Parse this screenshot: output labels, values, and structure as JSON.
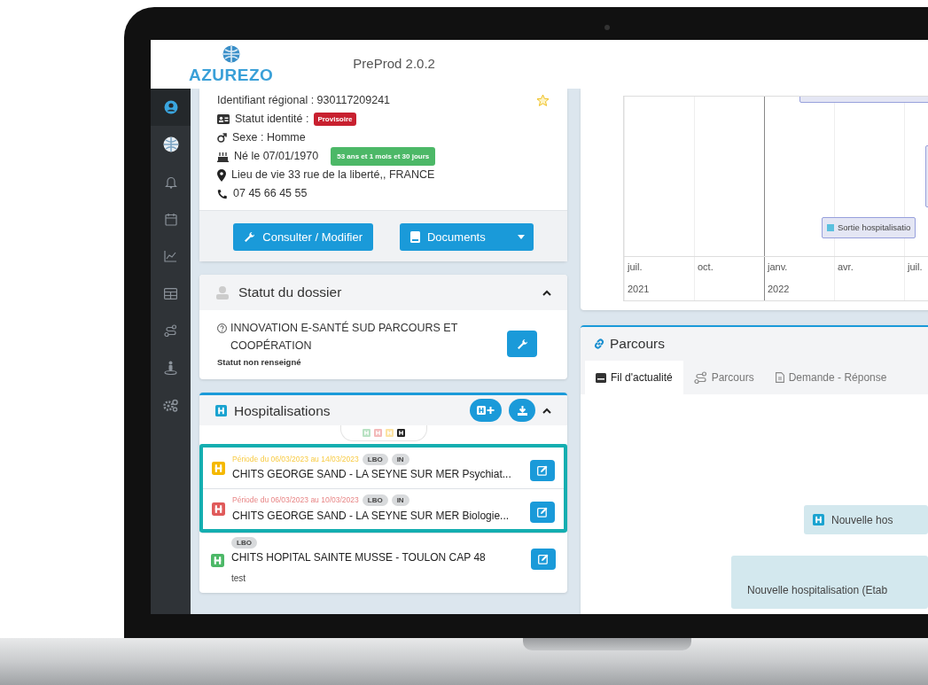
{
  "header": {
    "logo": "AZU**REZO**",
    "version": "PreProd 2.0.2"
  },
  "sidebar": {
    "items": [
      {
        "kind": "user",
        "selected": true
      },
      {
        "kind": "globe",
        "selected": false
      },
      {
        "kind": "bell",
        "selected": false
      },
      {
        "kind": "calendar",
        "selected": false
      },
      {
        "kind": "chart",
        "selected": false
      },
      {
        "kind": "table",
        "selected": false
      },
      {
        "kind": "route",
        "selected": false
      },
      {
        "kind": "person",
        "selected": false
      },
      {
        "kind": "gears",
        "selected": false
      }
    ]
  },
  "patient": {
    "favorite": false,
    "lines": [
      {
        "kind": "plain",
        "text": "Identifiant régional : 930117209241"
      },
      {
        "kind": "idcard",
        "text": "Statut identité :",
        "badge": "Provisoire",
        "color": "#c8202f"
      },
      {
        "kind": "male",
        "text": "Sexe : Homme"
      },
      {
        "kind": "cake",
        "text": "Né le 07/01/1970",
        "badge": "53 ans et 1 mois et 30 jours",
        "color": "#4cb867"
      },
      {
        "kind": "pin",
        "text": "Lieu de vie 33 rue de la liberté,, FRANCE"
      },
      {
        "kind": "phone",
        "text": "07 45 66 45 55"
      }
    ],
    "buttons": [
      {
        "kind": "wrench",
        "label": "Consulter / Modifier",
        "dropdown": false
      },
      {
        "kind": "book",
        "label": "Documents",
        "dropdown": true
      }
    ]
  },
  "dossier": {
    "title": "Statut du dossier",
    "expanded": true,
    "organisation": "INNOVATION E-SANTÉ SUD PARCOURS ET COOPÉRATION",
    "status": "Statut non renseigné"
  },
  "hospitalisations": {
    "title": "Hospitalisations",
    "expanded": true,
    "filters": [
      {
        "color": "#b8e2c3"
      },
      {
        "color": "#f3b9b9"
      },
      {
        "color": "#fce3a2"
      },
      {
        "color": "#222222"
      }
    ],
    "items": [
      {
        "color": "#f5b800",
        "period": "Période du 06/03/2023 au 14/03/2023",
        "badges": [
          "LBO",
          "IN"
        ],
        "name": "CHITS GEORGE SAND - LA SEYNE SUR MER Psychiat...",
        "highlighted": true
      },
      {
        "color": "#e05a5a",
        "period": "Période du 06/03/2023 au 10/03/2023",
        "badges": [
          "LBO",
          "IN"
        ],
        "name": "CHITS GEORGE SAND - LA SEYNE SUR MER Biologie...",
        "highlighted": true
      },
      {
        "color": "#4cb867",
        "badges": [
          "LBO"
        ],
        "name": "CHITS HOPITAL SAINTE MUSSE - TOULON CAP 48",
        "note": "test",
        "highlighted": false
      }
    ]
  },
  "timeline": {
    "axis": [
      {
        "month": "juil.",
        "year": "2021",
        "major": false
      },
      {
        "month": "oct.",
        "major": false
      },
      {
        "month": "janv.",
        "year": "2022",
        "major": true
      },
      {
        "month": "avr.",
        "major": false
      },
      {
        "month": "juil.",
        "major": false
      }
    ],
    "items": [
      {
        "label": "Sortie hospitalisatio"
      }
    ]
  },
  "parcours": {
    "title": "Parcours",
    "tabs": [
      {
        "kind": "feed",
        "label": "Fil d'actualité",
        "selected": true
      },
      {
        "kind": "route",
        "label": "Parcours",
        "selected": false
      },
      {
        "kind": "doc",
        "label": "Demande - Réponse",
        "selected": false
      }
    ],
    "feed": [
      {
        "kind": "hospital",
        "text": "Nouvelle hos"
      },
      {
        "kind": "plain",
        "text": "Nouvelle hospitalisation (Etab"
      }
    ]
  }
}
